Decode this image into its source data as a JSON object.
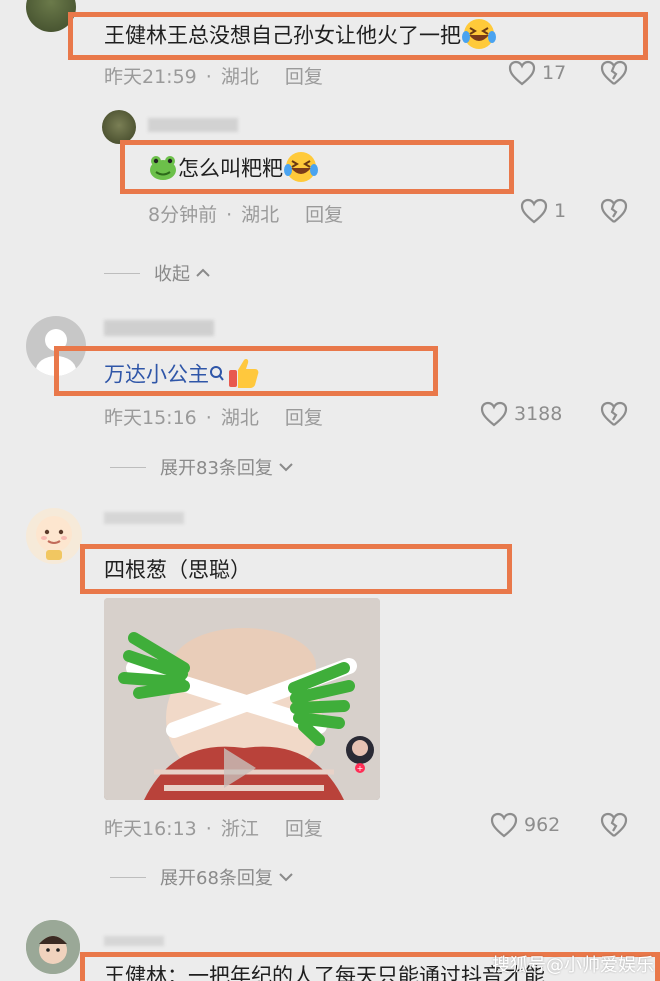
{
  "comments": [
    {
      "text": "王健林王总没想自己孙女让他火了一把",
      "time": "昨天21:59",
      "location": "湖北",
      "reply_label": "回复",
      "likes": "17"
    },
    {
      "text": "怎么叫粑粑",
      "time": "8分钟前",
      "location": "湖北",
      "reply_label": "回复",
      "likes": "1"
    },
    {
      "text": "万达小公主",
      "time": "昨天15:16",
      "location": "湖北",
      "reply_label": "回复",
      "likes": "3188",
      "expand_label": "展开83条回复"
    },
    {
      "text": "四根葱（思聪）",
      "time": "昨天16:13",
      "location": "浙江",
      "reply_label": "回复",
      "likes": "962",
      "expand_label": "展开68条回复"
    },
    {
      "text": "王健林：一把年纪的人了每天只能通过抖音才能"
    }
  ],
  "collapse_label": "收起",
  "watermark": "搜狐号@小帅爱娱乐",
  "colors": {
    "highlight_border": "#e9784a",
    "background": "#ececec",
    "meta_text": "#9a9a9a"
  },
  "icons": [
    "heart-outline-icon",
    "broken-heart-icon",
    "chevron-up-icon",
    "chevron-down-icon",
    "search-icon",
    "frog-emoji",
    "laughing-tears-emoji",
    "thumbs-up-emoji"
  ]
}
